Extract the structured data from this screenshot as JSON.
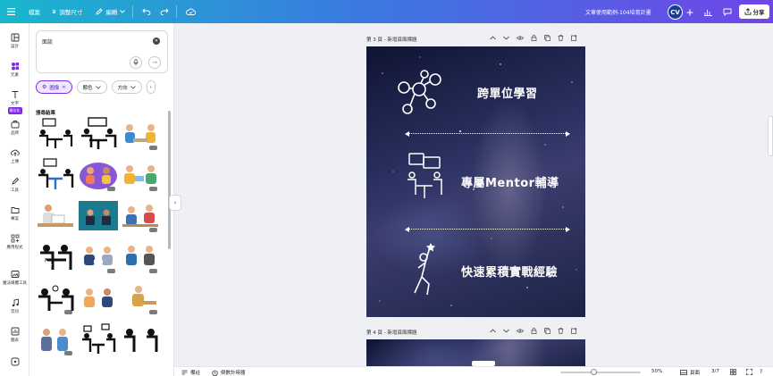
{
  "topbar": {
    "menu_icon": "hamburger-icon",
    "file_label": "檔案",
    "resize_label": "調整尺寸",
    "edit_label": "編輯",
    "doc_title": "文章使用範例-104培育計畫",
    "avatar_initials": "CV",
    "share_label": "分享"
  },
  "rail": [
    {
      "label": "設計",
      "icon": "layout-icon"
    },
    {
      "label": "元素",
      "icon": "elements-icon"
    },
    {
      "label": "文字",
      "icon": "text-icon",
      "badge": "最佳化"
    },
    {
      "label": "品牌",
      "icon": "brand-icon"
    },
    {
      "label": "上傳",
      "icon": "upload-icon"
    },
    {
      "label": "工具",
      "icon": "draw-icon"
    },
    {
      "label": "專案",
      "icon": "folder-icon"
    },
    {
      "label": "應用程式",
      "icon": "apps-icon"
    },
    {
      "label": "魔法媒體工具",
      "icon": "magic-media-icon"
    },
    {
      "label": "音訊",
      "icon": "music-icon"
    },
    {
      "label": "圖表",
      "icon": "chart-icon"
    }
  ],
  "panel": {
    "search_value": "面談",
    "filter_chips": [
      "圖像",
      "顏色",
      "方向"
    ],
    "results_title": "搜尋結果"
  },
  "canvas": {
    "page3_header": "第 3 頁 - 新增頁面標題",
    "page4_header": "第 4 頁 - 新增頁面標題",
    "slide": {
      "line1": "跨單位學習",
      "line2": "專屬Mentor輔導",
      "line3": "快速累積實戰經驗"
    }
  },
  "bottombar": {
    "notes_label": "備註",
    "timer_label": "倒數計時器",
    "zoom_value": "50%",
    "pages_label": "頁面",
    "page_count": "3/7"
  }
}
